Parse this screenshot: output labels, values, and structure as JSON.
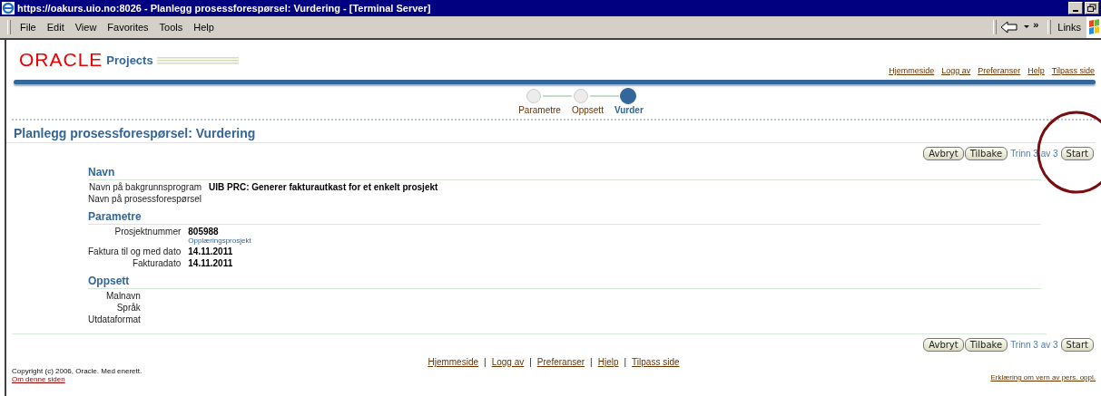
{
  "window": {
    "title": "https://oakurs.uio.no:8026 - Planlegg prosessforespørsel: Vurdering - [Terminal Server]"
  },
  "menu": [
    "File",
    "Edit",
    "View",
    "Favorites",
    "Tools",
    "Help"
  ],
  "toolbar": {
    "links_label": "Links",
    "more": "»"
  },
  "header": {
    "brand": "ORACLE",
    "product": "Projects",
    "links": [
      "Hjemmeside",
      "Logg av",
      "Preferanser",
      "Help",
      "Tilpass side"
    ]
  },
  "train": [
    {
      "label": "Parametre",
      "selected": false
    },
    {
      "label": "Oppsett",
      "selected": false
    },
    {
      "label": "Vurder",
      "selected": true
    }
  ],
  "page_title": "Planlegg prosessforespørsel: Vurdering",
  "actions_top": {
    "buttons": [
      "Avbryt",
      "Tilbake"
    ],
    "step": "Trinn 3 av 3",
    "submit": "Start"
  },
  "sections": [
    {
      "heading": "Navn",
      "rows": [
        {
          "label": "Navn på bakgrunnsprogram",
          "value": "UIB PRC: Generer fakturautkast for et enkelt prosjekt"
        },
        {
          "label": "Navn på prosessforespørsel"
        }
      ]
    },
    {
      "heading": "Parametre",
      "rows": [
        {
          "label": "Prosjektnummer",
          "value": "805988",
          "note": "Opplæringsprosjekt"
        },
        {
          "label": "Faktura til og med dato",
          "value": "14.11.2011"
        },
        {
          "label": "Fakturadato",
          "value": "14.11.2011"
        }
      ]
    },
    {
      "heading": "Oppsett",
      "rows": [
        {
          "label": "Malnavn"
        },
        {
          "label": "Språk"
        },
        {
          "label": "Utdataformat"
        }
      ]
    }
  ],
  "actions_bottom": {
    "buttons": [
      "Avbryt",
      "Tilbake"
    ],
    "step": "Trinn 3 av 3",
    "submit": "Start"
  },
  "footer": {
    "separator": "|",
    "links": [
      "Hjemmeside",
      "Logg av",
      "Preferanser",
      "Hjelp",
      "Tilpass side"
    ],
    "copyright": "Copyright (c) 2006, Oracle. Med enerett.",
    "about": "Om denne siden",
    "privacy": "Erklæring om vern av pers. oppl."
  }
}
